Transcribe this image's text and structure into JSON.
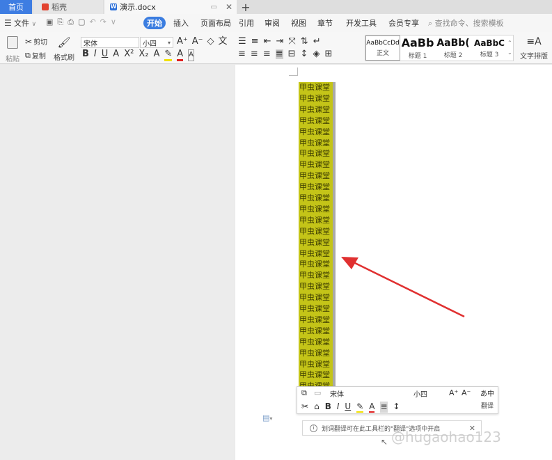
{
  "tabs": {
    "home": "首页",
    "daoke": "稻壳",
    "document": "演示.docx",
    "new_tab": "+"
  },
  "menu": {
    "file": "文件",
    "start": "开始",
    "items": [
      "插入",
      "页面布局",
      "引用",
      "审阅",
      "视图",
      "章节",
      "开发工具",
      "会员专享"
    ],
    "search_placeholder": "查找命令、搜索模板"
  },
  "ribbon": {
    "paste": "粘贴",
    "cut": "剪切",
    "copy": "复制",
    "format_painter": "格式刷",
    "font_name": "宋体",
    "font_size": "小四",
    "text_layout": "文字排版"
  },
  "styles": [
    {
      "sample": "AaBbCcDd",
      "name": "正文"
    },
    {
      "sample": "AaBb",
      "name": "标题 1"
    },
    {
      "sample": "AaBb(",
      "name": "标题 2"
    },
    {
      "sample": "AaBbC",
      "name": "标题 3"
    }
  ],
  "document": {
    "line_text": "甲虫课堂",
    "line_count": 28,
    "highlight_color": "#c4c418"
  },
  "mini_toolbar": {
    "font_name": "宋体",
    "font_size": "小四",
    "translate": "翻译"
  },
  "notice": {
    "text": "划词翻译可在此工具栏的\"翻译\"选项中开启"
  },
  "watermark": "@hugaohao123",
  "colors": {
    "accent": "#3b7de0",
    "arrow": "#e03030"
  }
}
